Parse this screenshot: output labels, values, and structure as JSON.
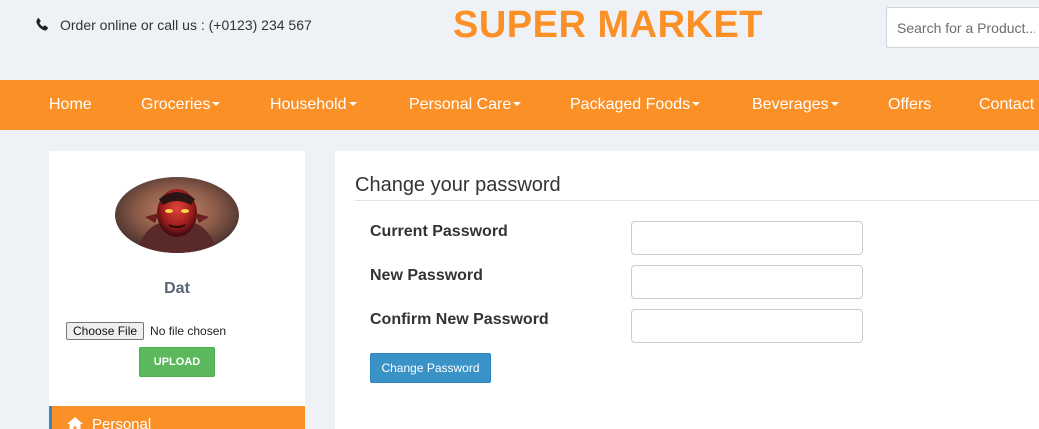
{
  "header": {
    "contact_text": "Order online or call us : (+0123) 234 567",
    "brand": "SUPER MARKET",
    "search_placeholder": "Search for a Product..."
  },
  "nav": {
    "items": [
      {
        "label": "Home",
        "dropdown": false
      },
      {
        "label": "Groceries",
        "dropdown": true
      },
      {
        "label": "Household",
        "dropdown": true
      },
      {
        "label": "Personal Care",
        "dropdown": true
      },
      {
        "label": "Packaged Foods",
        "dropdown": true
      },
      {
        "label": "Beverages",
        "dropdown": true
      },
      {
        "label": "Offers",
        "dropdown": false
      },
      {
        "label": "Contact",
        "dropdown": false
      }
    ]
  },
  "sidebar": {
    "username": "Dat",
    "choose_file_label": "Choose File",
    "file_status": "No file chosen",
    "upload_label": "UPLOAD",
    "menu_item": "Personal"
  },
  "form": {
    "title": "Change your password",
    "current_password_label": "Current Password",
    "new_password_label": "New Password",
    "confirm_password_label": "Confirm New Password",
    "current_password_value": "",
    "new_password_value": "",
    "confirm_password_value": "",
    "submit_label": "Change Password"
  },
  "colors": {
    "brand_orange": "#fb9027",
    "upload_green": "#5cb85c",
    "submit_blue": "#3a93c7",
    "background": "#eef1f6"
  }
}
